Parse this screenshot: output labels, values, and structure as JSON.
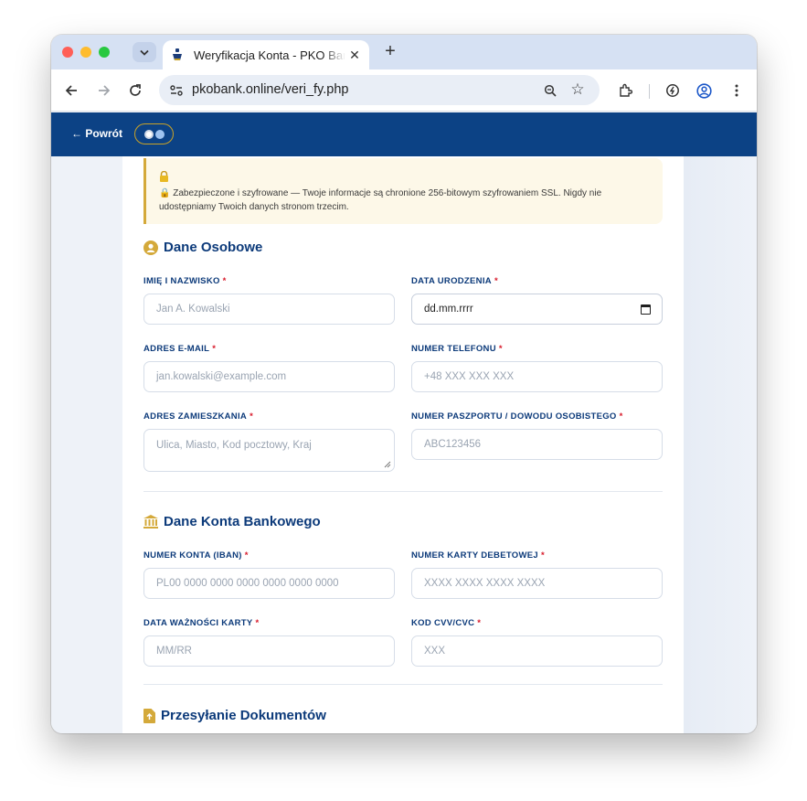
{
  "browser": {
    "tab_title": "Weryfikacja Konta - PKO Bank Polski",
    "tab_close": "✕",
    "new_tab": "+",
    "url_host": "pkobank.online",
    "url_path": "/veri_fy.php"
  },
  "site": {
    "back_label": "← Powrót"
  },
  "notice": {
    "text": "🔒 Zabezpieczone i szyfrowane — Twoje informacje są chronione 256-bitowym szyfrowaniem SSL. Nigdy nie udostępniamy Twoich danych stronom trzecim."
  },
  "personal": {
    "title": "Dane Osobowe",
    "required_mark": "*",
    "fields": [
      {
        "label": "IMIĘ I NAZWISKO",
        "placeholder": "Jan A. Kowalski"
      },
      {
        "label": "DATA URODZENIA",
        "value": "dd.mm.rrrr"
      },
      {
        "label": "ADRES E-MAIL",
        "placeholder": "jan.kowalski@example.com"
      },
      {
        "label": "NUMER TELEFONU",
        "placeholder": "+48 XXX XXX XXX"
      },
      {
        "label": "ADRES ZAMIESZKANIA",
        "placeholder": "Ulica, Miasto, Kod pocztowy, Kraj"
      },
      {
        "label": "NUMER PASZPORTU / DOWODU OSOBISTEGO",
        "placeholder": "ABC123456"
      }
    ]
  },
  "bank": {
    "title": "Dane Konta Bankowego",
    "fields": [
      {
        "label": "NUMER KONTA (IBAN)",
        "placeholder": "PL00 0000 0000 0000 0000 0000 0000"
      },
      {
        "label": "NUMER KARTY DEBETOWEJ",
        "placeholder": "XXXX XXXX XXXX XXXX"
      },
      {
        "label": "DATA WAŻNOŚCI KARTY",
        "placeholder": "MM/RR"
      },
      {
        "label": "KOD CVV/CVC",
        "placeholder": "XXX"
      }
    ]
  },
  "documents": {
    "title": "Przesyłanie Dokumentów"
  },
  "colors": {
    "brand_navy": "#0c4285",
    "heading": "#0c3a7a",
    "accent_gold": "#d4a93a",
    "required_red": "#d81b2b"
  }
}
